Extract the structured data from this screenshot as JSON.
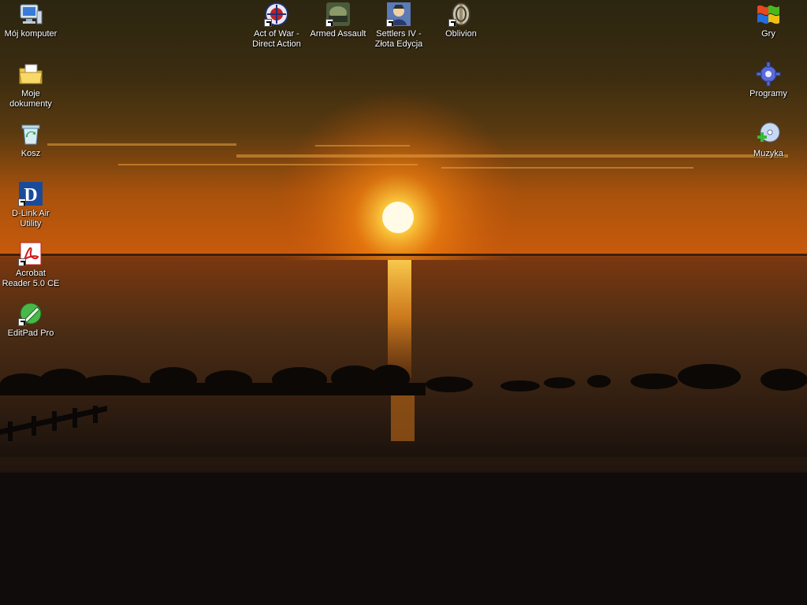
{
  "desktop": {
    "left_icons": [
      {
        "label": "Mój komputer",
        "icon": "my-computer-icon"
      },
      {
        "label": "Moje dokumenty",
        "icon": "my-documents-icon"
      },
      {
        "label": "Kosz",
        "icon": "recycle-bin-icon"
      },
      {
        "label": "D-Link Air Utility",
        "icon": "dlink-icon"
      },
      {
        "label": "Acrobat Reader 5.0 CE",
        "icon": "acrobat-reader-icon"
      },
      {
        "label": "EditPad Pro",
        "icon": "editpad-icon"
      }
    ],
    "top_icons": [
      {
        "label": "Act of War - Direct Action",
        "icon": "act-of-war-icon"
      },
      {
        "label": "Armed Assault",
        "icon": "armed-assault-icon"
      },
      {
        "label": "Settlers IV - Złota Edycja",
        "icon": "settlers-iv-icon"
      },
      {
        "label": "Oblivion",
        "icon": "oblivion-icon"
      }
    ],
    "right_icons": [
      {
        "label": "Gry",
        "icon": "games-flag-icon"
      },
      {
        "label": "Programy",
        "icon": "programs-gear-icon"
      },
      {
        "label": "Muzyka",
        "icon": "music-cd-icon"
      }
    ]
  },
  "colors": {
    "sky_top": "#2a2410",
    "sun": "#fff6c8",
    "horizon_glow": "#e87a10",
    "sea": "#3a2412",
    "sand": "#120e0c"
  }
}
